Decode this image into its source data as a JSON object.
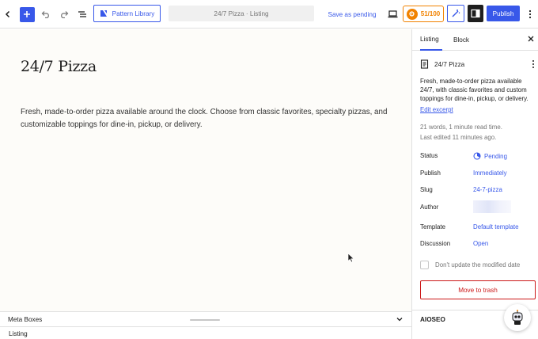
{
  "toolbar": {
    "pattern_library_label": "Pattern Library",
    "document_title": "24/7 Pizza · Listing",
    "save_pending_label": "Save as pending",
    "seo_score": "51/100",
    "publish_label": "Publish"
  },
  "editor": {
    "post_title": "24/7 Pizza",
    "post_body": "Fresh, made-to-order pizza available around the clock. Choose from classic favorites, specialty pizzas, and customizable toppings for dine-in, pickup, or delivery."
  },
  "meta_boxes": {
    "label": "Meta Boxes",
    "breadcrumb": "Listing"
  },
  "sidebar": {
    "tabs": [
      "Listing",
      "Block"
    ],
    "document_name": "24/7 Pizza",
    "excerpt": "Fresh, made-to-order pizza available 24/7, with classic favorites and custom toppings for dine-in, pickup, or delivery.",
    "edit_excerpt_label": "Edit excerpt",
    "stats": "21 words, 1 minute read time.",
    "last_edited": "Last edited 11 minutes ago.",
    "properties": {
      "status": {
        "label": "Status",
        "value": "Pending"
      },
      "publish": {
        "label": "Publish",
        "value": "Immediately"
      },
      "slug": {
        "label": "Slug",
        "value": "24-7-pizza"
      },
      "author": {
        "label": "Author",
        "value": ""
      },
      "template": {
        "label": "Template",
        "value": "Default template"
      },
      "discussion": {
        "label": "Discussion",
        "value": "Open"
      }
    },
    "dont_update_label": "Don't update the modified date",
    "trash_label": "Move to trash",
    "aioseo_label": "AIOSEO"
  },
  "colors": {
    "accent": "#3858e9",
    "score": "#f18200",
    "danger": "#cc1818",
    "canvas": "#fdfcf9"
  }
}
